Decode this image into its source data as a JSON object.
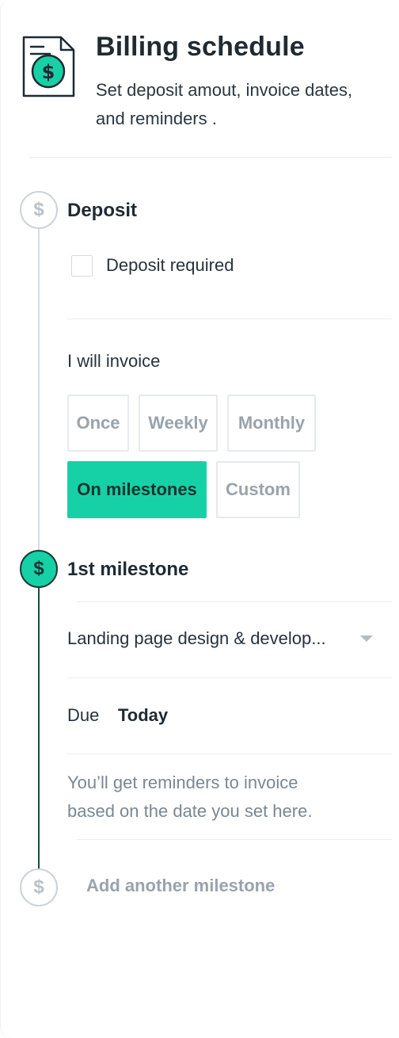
{
  "header": {
    "title": "Billing schedule",
    "subtitle_line1": "Set deposit amout, invoice dates,",
    "subtitle_line2": "and reminders .",
    "icon": "invoice-dollar-icon",
    "accent_color": "#17d1a6"
  },
  "deposit": {
    "node_symbol": "$",
    "title": "Deposit",
    "checkbox_label": "Deposit required",
    "checked": false
  },
  "invoice": {
    "label": "I will invoice",
    "options": [
      "Once",
      "Weekly",
      "Monthly",
      "On milestones",
      "Custom"
    ],
    "selected": "On milestones"
  },
  "milestone": {
    "node_symbol": "$",
    "title": "1st milestone",
    "selected_project": "Landing page design & develop...",
    "due_label": "Due",
    "due_value": "Today",
    "hint_line1": "You’ll get reminders to invoice",
    "hint_line2": "based on the date you set here."
  },
  "add_milestone": {
    "node_symbol": "$",
    "label": "Add another milestone"
  },
  "colors": {
    "accent": "#17d1a6",
    "timeline_active": "#1b4a46",
    "timeline_inactive": "#d6dde3",
    "muted_text": "#9aa3ac"
  }
}
